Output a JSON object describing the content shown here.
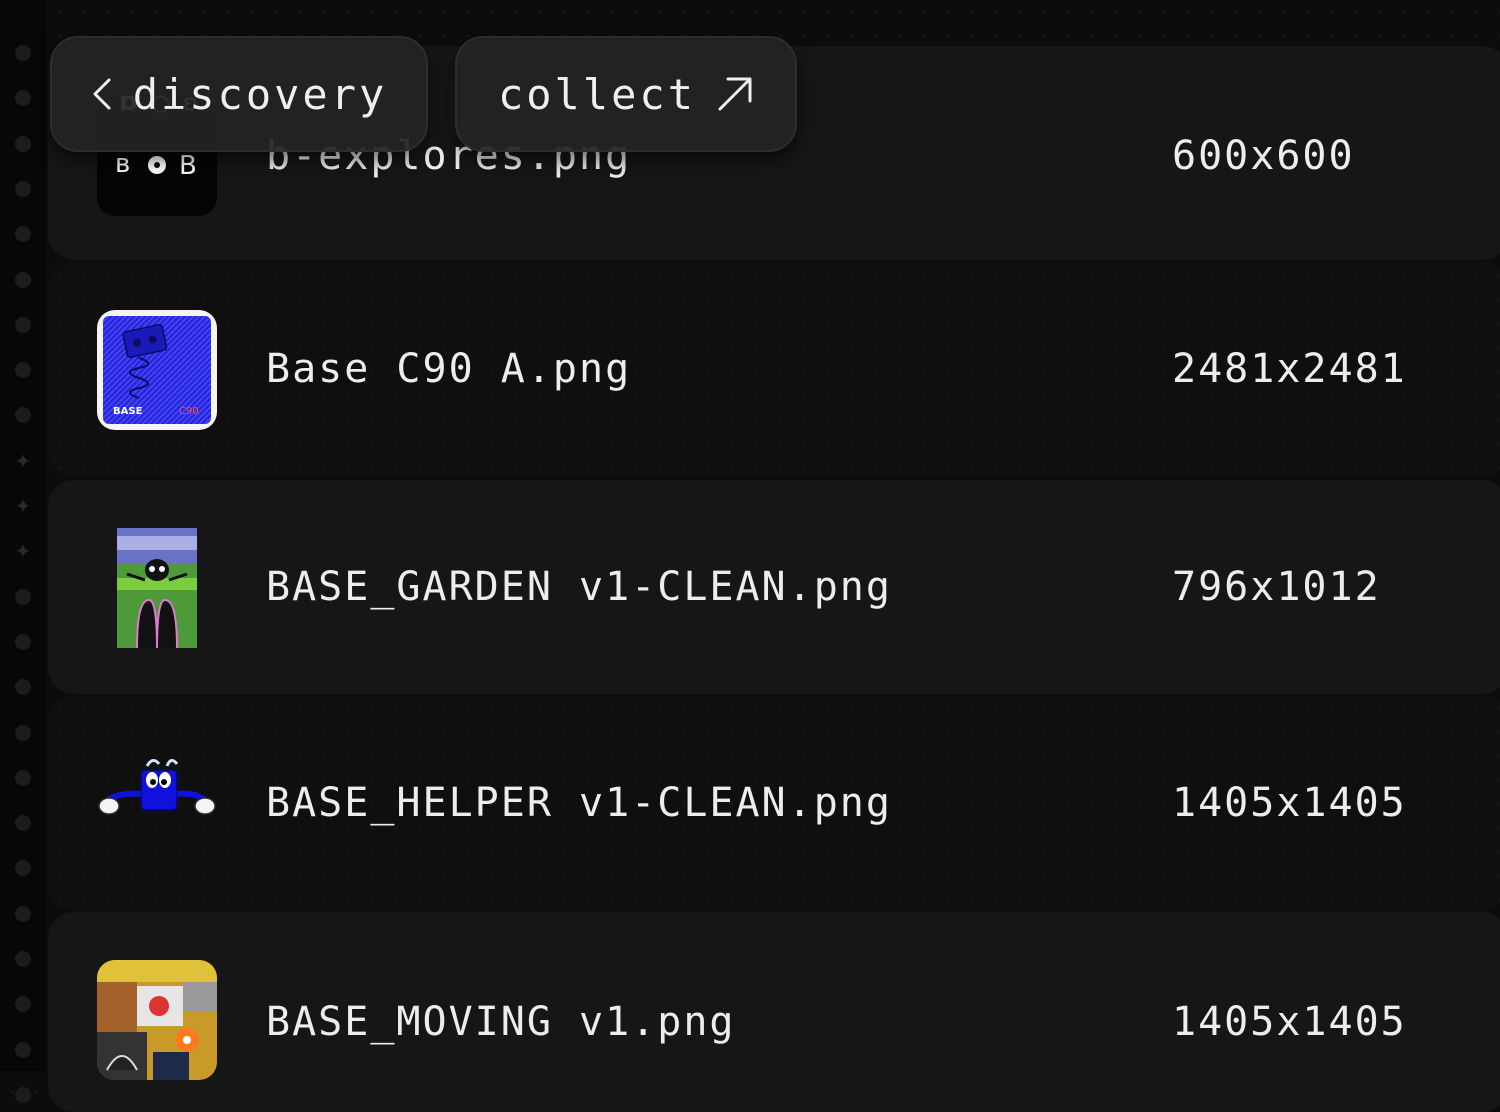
{
  "nav": {
    "back_label": "discovery",
    "collect_label": "collect"
  },
  "files": [
    {
      "name": "b-explores.png",
      "dimensions": "600x600",
      "thumbnail": "b-explores-grid"
    },
    {
      "name": "Base C90 A.png",
      "dimensions": "2481x2481",
      "thumbnail": "base-c90-cassette-poster"
    },
    {
      "name": "BASE_GARDEN v1-CLEAN.png",
      "dimensions": "796x1012",
      "thumbnail": "base-garden-character"
    },
    {
      "name": "BASE_HELPER v1-CLEAN.png",
      "dimensions": "1405x1405",
      "thumbnail": "base-helper-character"
    },
    {
      "name": "BASE_MOVING v1.png",
      "dimensions": "1405x1405",
      "thumbnail": "base-moving-collage"
    }
  ],
  "thumb_text": {
    "c90_brand": "BASE",
    "c90_code": "C90"
  },
  "colors": {
    "background": "#0c0c0c",
    "row": "#161616",
    "pill": "#242424",
    "text": "#ececec",
    "base_blue": "#2222dd"
  }
}
